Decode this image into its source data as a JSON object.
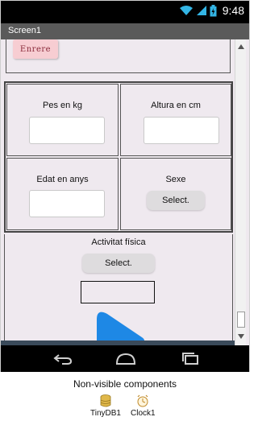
{
  "status_bar": {
    "time": "9:48"
  },
  "title_bar": {
    "title": "Screen1"
  },
  "header": {
    "back_button_label": "Enrere"
  },
  "form": {
    "weight": {
      "label": "Pes en kg",
      "value": ""
    },
    "height": {
      "label": "Altura en cm",
      "value": ""
    },
    "age": {
      "label": "Edat en anys",
      "value": ""
    },
    "sex": {
      "label": "Sexe",
      "button_label": "Select."
    },
    "activity": {
      "label": "Activitat física",
      "button_label": "Select.",
      "result": ""
    }
  },
  "play_button": {
    "icon": "play-icon",
    "color": "#1e88e5"
  },
  "nav_bar": {
    "icons": [
      "back-icon",
      "home-icon",
      "recent-apps-icon"
    ]
  },
  "non_visible": {
    "title": "Non-visible components",
    "components": [
      {
        "name": "TinyDB1",
        "icon": "database-icon"
      },
      {
        "name": "Clock1",
        "icon": "clock-icon"
      }
    ]
  },
  "colors": {
    "screen_background": "#efe9ef",
    "title_bar": "#5a5a5a",
    "back_button": "#f7cdd2",
    "accent": "#1e88e5"
  }
}
